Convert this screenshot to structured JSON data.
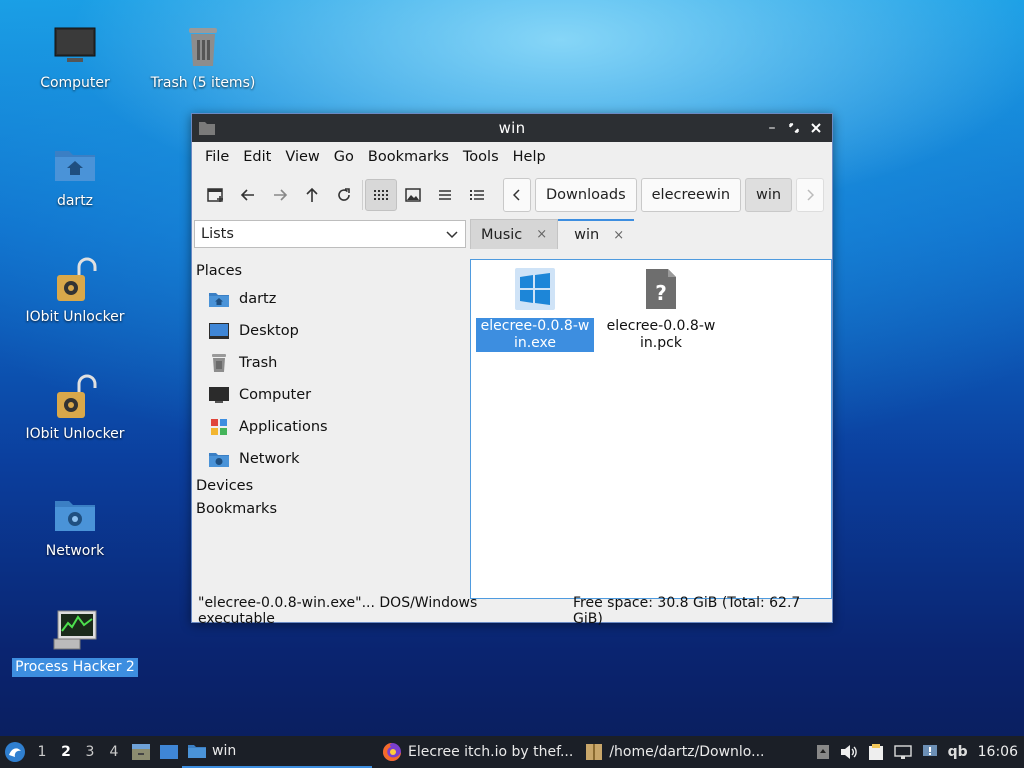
{
  "desktop": {
    "icons": [
      {
        "label": "Computer"
      },
      {
        "label": "Trash (5 items)"
      },
      {
        "label": "dartz"
      },
      {
        "label": "IObit Unlocker"
      },
      {
        "label": "IObit Unlocker"
      },
      {
        "label": "Network"
      },
      {
        "label": "Process Hacker 2"
      }
    ]
  },
  "window": {
    "title": "win",
    "menu": [
      "File",
      "Edit",
      "View",
      "Go",
      "Bookmarks",
      "Tools",
      "Help"
    ],
    "breadcrumb": [
      "Downloads",
      "elecreewin",
      "win"
    ],
    "side_pane_mode": "Lists",
    "tabs": [
      {
        "label": "Music",
        "close": "×"
      },
      {
        "label": "win",
        "close": "×"
      }
    ],
    "sidebar": {
      "places_header": "Places",
      "places": [
        {
          "label": "dartz",
          "icon": "home-folder-icon"
        },
        {
          "label": "Desktop",
          "icon": "desktop-icon"
        },
        {
          "label": "Trash",
          "icon": "trash-icon"
        },
        {
          "label": "Computer",
          "icon": "computer-icon"
        },
        {
          "label": "Applications",
          "icon": "applications-icon"
        },
        {
          "label": "Network",
          "icon": "network-folder-icon"
        }
      ],
      "devices_header": "Devices",
      "bookmarks_header": "Bookmarks"
    },
    "files": [
      {
        "name": "elecree-0.0.8-win.exe",
        "icon": "windows-exe-icon",
        "selected": true
      },
      {
        "name": "elecree-0.0.8-win.pck",
        "icon": "unknown-file-icon",
        "selected": false
      }
    ],
    "status": {
      "selection": "\"elecree-0.0.8-win.exe\"... DOS/Windows executable",
      "free_space": "Free space: 30.8 GiB (Total: 62.7 GiB)"
    }
  },
  "taskbar": {
    "workspaces": [
      "1",
      "2",
      "3",
      "4"
    ],
    "current_workspace": "2",
    "tasks": [
      {
        "label": "win"
      },
      {
        "label": "Elecree itch.io by thef..."
      },
      {
        "label": "/home/dartz/Downlo..."
      }
    ],
    "tray_qb": "qb",
    "clock": "16:06"
  },
  "colors": {
    "accent": "#3d8ee0",
    "titlebar": "#2c2f33",
    "taskbar": "#1b1f27"
  }
}
